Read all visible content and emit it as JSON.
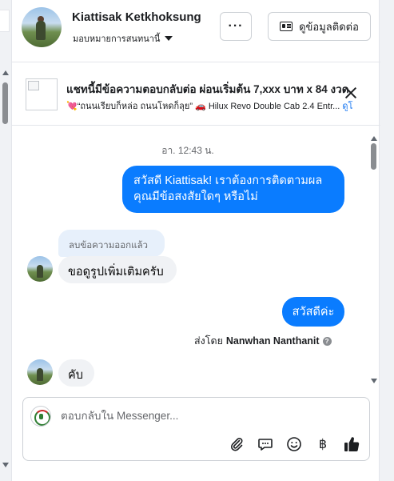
{
  "header": {
    "contact_name": "Kiattisak Ketkhoksung",
    "assign_label": "มอบหมายการสนทนานี้",
    "more_label": "···",
    "contact_info_label": "ดูข้อมูลติดต่อ"
  },
  "ad": {
    "title": "แชทนี้มีข้อความตอบกลับต่อ ผ่อนเริ่มต้น 7,xxx บาท x 84 งวด",
    "subtitle_quote": "“ถนนเรียบก็หล่อ ถนนโหดก็ลุย”",
    "subtitle_model": "Hilux Revo Double Cab 2.4 Entr...",
    "subtitle_link": "ดูโ"
  },
  "conversation": {
    "timestamp": "อา. 12:43 น.",
    "messages": [
      {
        "from": "page",
        "text": "สวัสดี Kiattisak! เราต้องการติดตามผล คุณมีข้อสงสัยใดๆ หรือไม่"
      },
      {
        "from": "user",
        "removed_label": "ลบข้อความออกแล้ว",
        "text": "ขอดูรูปเพิ่มเติมครับ"
      },
      {
        "from": "page",
        "text": "สวัสดีค่ะ"
      },
      {
        "from": "user",
        "text": "คับ"
      }
    ],
    "sent_by_prefix": "ส่งโดย",
    "sent_by_name": "Nanwhan Nanthanit",
    "info_icon_label": "?"
  },
  "composer": {
    "placeholder": "ตอบกลับใน Messenger...",
    "tools": [
      "attachment-icon",
      "saved-reply-icon",
      "emoji-icon",
      "baht-icon",
      "like-icon"
    ]
  },
  "colors": {
    "accent": "#0a7cff",
    "incoming_bubble": "#f0f2f5",
    "removed_bubble": "#e7f0fb",
    "link": "#1877f2"
  }
}
